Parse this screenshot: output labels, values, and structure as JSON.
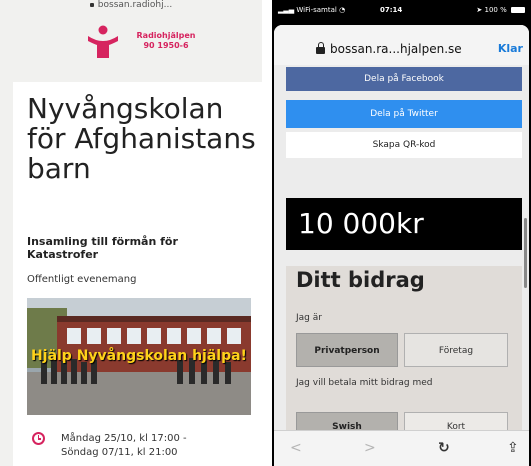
{
  "left_page": {
    "url": "bossan.radiohj...",
    "logo": {
      "line1": "Radiohjälpen",
      "line2": "90 1950-6"
    },
    "title": "Nyvångskolan för Afghanistans barn",
    "subtitle": "Insamling till förmån för Katastrofer",
    "event_type": "Offentligt evenemang",
    "photo_caption": "Hjälp Nyvångskolan hjälpa!",
    "date_line1": "Måndag 25/10, kl 17:00 -",
    "date_line2": "Söndag 07/11, kl 21:00"
  },
  "status_bar": {
    "carrier": "WiFi-samtal",
    "time": "07:14",
    "battery": "100 %"
  },
  "browser": {
    "address": "bossan.ra...hjalpen.se",
    "done_label": "Klar"
  },
  "share": {
    "facebook": "Dela på Facebook",
    "twitter": "Dela på Twitter",
    "qr": "Skapa QR-kod"
  },
  "amount": "10 000kr",
  "contribution": {
    "title": "Ditt bidrag",
    "donor_label": "Jag är",
    "private_label": "Privatperson",
    "company_label": "Företag",
    "pay_label": "Jag vill betala mitt bidrag med",
    "swish_label": "Swish",
    "card_label": "Kort"
  },
  "toolbar": {
    "back": "<",
    "forward": ">",
    "reload": "↻",
    "share": "⇪"
  },
  "colors": {
    "brand": "#d6245f",
    "facebook": "#3c5a99",
    "twitter": "#2f8fef",
    "link": "#1a7bd9"
  }
}
